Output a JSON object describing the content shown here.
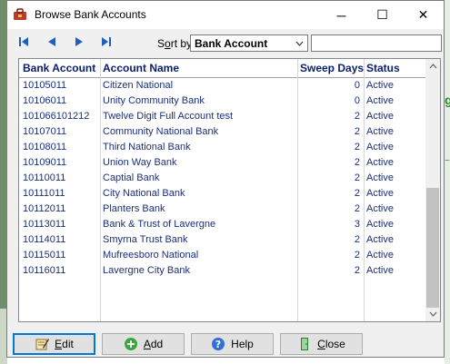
{
  "window": {
    "title": "Browse Bank Accounts",
    "minimize_glyph": "─",
    "maximize_glyph": "☐",
    "close_glyph": "✕"
  },
  "toolbar": {
    "sort_label_prefix": "S",
    "sort_label_accel": "o",
    "sort_label_suffix": "rt by",
    "sort_value": "Bank Account",
    "search_value": ""
  },
  "table": {
    "columns": [
      "Bank Account",
      "Account Name",
      "Sweep Days",
      "Status"
    ],
    "rows": [
      {
        "account": "10105011",
        "name": "Citizen National",
        "sweep_days": "0",
        "status": "Active"
      },
      {
        "account": "10106011",
        "name": "Unity Community Bank",
        "sweep_days": "0",
        "status": "Active"
      },
      {
        "account": "101066101212",
        "name": "Twelve Digit Full Account test",
        "sweep_days": "2",
        "status": "Active"
      },
      {
        "account": "10107011",
        "name": "Community National Bank",
        "sweep_days": "2",
        "status": "Active"
      },
      {
        "account": "10108011",
        "name": "Third National Bank",
        "sweep_days": "2",
        "status": "Active"
      },
      {
        "account": "10109011",
        "name": "Union Way Bank",
        "sweep_days": "2",
        "status": "Active"
      },
      {
        "account": "10110011",
        "name": "Captial Bank",
        "sweep_days": "2",
        "status": "Active"
      },
      {
        "account": "10111011",
        "name": "City National Bank",
        "sweep_days": "2",
        "status": "Active"
      },
      {
        "account": "10112011",
        "name": "Planters Bank",
        "sweep_days": "2",
        "status": "Active"
      },
      {
        "account": "10113011",
        "name": "Bank & Trust of Lavergne",
        "sweep_days": "3",
        "status": "Active"
      },
      {
        "account": "10114011",
        "name": "Smyrna Trust Bank",
        "sweep_days": "2",
        "status": "Active"
      },
      {
        "account": "10115011",
        "name": "Mufreesboro National",
        "sweep_days": "2",
        "status": "Active"
      },
      {
        "account": "10116011",
        "name": "Lavergne City Bank",
        "sweep_days": "2",
        "status": "Active"
      }
    ]
  },
  "buttons": {
    "edit": {
      "accel": "E",
      "rest": "dit"
    },
    "add": {
      "accel": "A",
      "rest": "dd"
    },
    "help": {
      "label": "Help"
    },
    "close": {
      "accel": "C",
      "rest": "lose"
    }
  },
  "colors": {
    "header_text": "#0a1f6b",
    "row_text": "#1a2f7a",
    "focus_border": "#0078d7"
  }
}
